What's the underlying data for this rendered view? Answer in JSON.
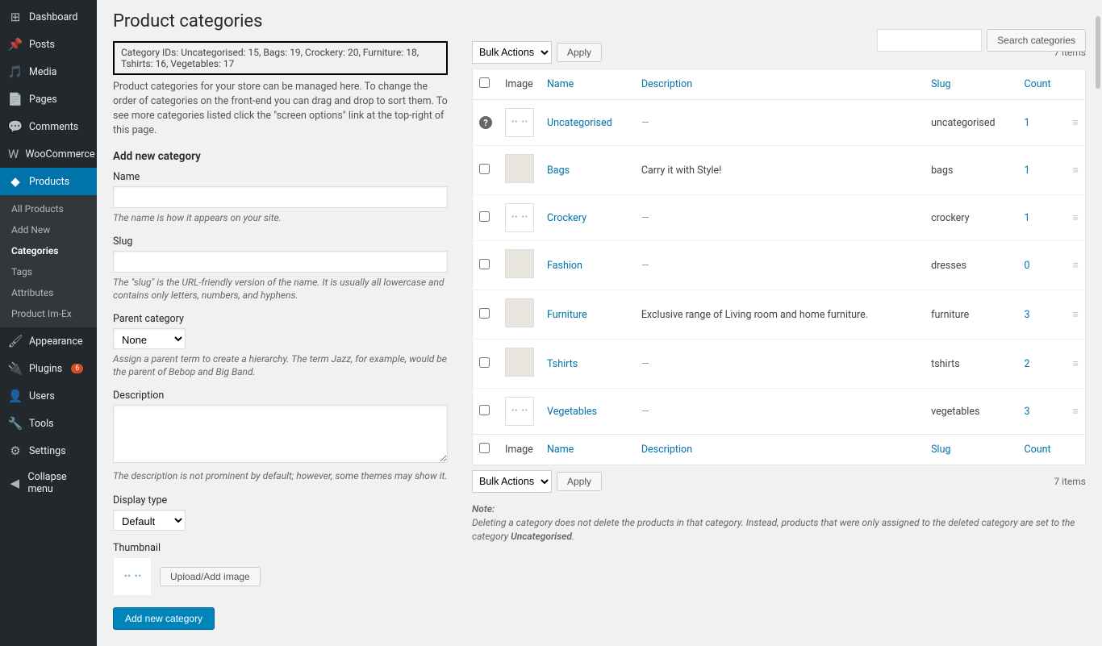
{
  "sidebar": {
    "items": [
      {
        "label": "Dashboard",
        "icon": "dashboard-icon"
      },
      {
        "label": "Posts",
        "icon": "pin-icon"
      },
      {
        "label": "Media",
        "icon": "media-icon"
      },
      {
        "label": "Pages",
        "icon": "page-icon"
      },
      {
        "label": "Comments",
        "icon": "comment-icon"
      },
      {
        "label": "WooCommerce",
        "icon": "woo-icon"
      },
      {
        "label": "Products",
        "icon": "product-icon",
        "active": true
      },
      {
        "label": "Appearance",
        "icon": "brush-icon"
      },
      {
        "label": "Plugins",
        "icon": "plug-icon",
        "badge": "6"
      },
      {
        "label": "Users",
        "icon": "user-icon"
      },
      {
        "label": "Tools",
        "icon": "wrench-icon"
      },
      {
        "label": "Settings",
        "icon": "gear-icon"
      },
      {
        "label": "Collapse menu",
        "icon": "collapse-icon"
      }
    ],
    "submenu": [
      "All Products",
      "Add New",
      "Categories",
      "Tags",
      "Attributes",
      "Product Im-Ex"
    ],
    "submenu_current": "Categories"
  },
  "page_title": "Product categories",
  "search": {
    "button": "Search categories"
  },
  "category_ids_label": "Category IDs:",
  "category_ids_value": "Uncategorised: 15, Bags: 19, Crockery: 20, Furniture: 18, Tshirts: 16, Vegetables: 17",
  "intro_help": "Product categories for your store can be managed here. To change the order of categories on the front-end you can drag and drop to sort them. To see more categories listed click the \"screen options\" link at the top-right of this page.",
  "form": {
    "heading": "Add new category",
    "name_label": "Name",
    "name_hint": "The name is how it appears on your site.",
    "slug_label": "Slug",
    "slug_hint": "The \"slug\" is the URL-friendly version of the name. It is usually all lowercase and contains only letters, numbers, and hyphens.",
    "parent_label": "Parent category",
    "parent_value": "None",
    "parent_hint": "Assign a parent term to create a hierarchy. The term Jazz, for example, would be the parent of Bebop and Big Band.",
    "desc_label": "Description",
    "desc_hint": "The description is not prominent by default; however, some themes may show it.",
    "display_label": "Display type",
    "display_value": "Default",
    "thumb_label": "Thumbnail",
    "upload_btn": "Upload/Add image",
    "submit": "Add new category"
  },
  "bulk": {
    "label": "Bulk Actions",
    "apply": "Apply"
  },
  "items_count": "7 items",
  "columns": {
    "image": "Image",
    "name": "Name",
    "description": "Description",
    "slug": "Slug",
    "count": "Count"
  },
  "rows": [
    {
      "name": "Uncategorised",
      "description": "—",
      "slug": "uncategorised",
      "count": "1",
      "thumb": "wc",
      "qmark": true
    },
    {
      "name": "Bags",
      "description": "Carry it with Style!",
      "slug": "bags",
      "count": "1",
      "thumb": "img"
    },
    {
      "name": "Crockery",
      "description": "—",
      "slug": "crockery",
      "count": "1",
      "thumb": "wc"
    },
    {
      "name": "Fashion",
      "description": "—",
      "slug": "dresses",
      "count": "0",
      "thumb": "img"
    },
    {
      "name": "Furniture",
      "description": "Exclusive range of Living room and home furniture.",
      "slug": "furniture",
      "count": "3",
      "thumb": "img"
    },
    {
      "name": "Tshirts",
      "description": "—",
      "slug": "tshirts",
      "count": "2",
      "thumb": "img"
    },
    {
      "name": "Vegetables",
      "description": "—",
      "slug": "vegetables",
      "count": "3",
      "thumb": "wc"
    }
  ],
  "note_label": "Note:",
  "note_text": "Deleting a category does not delete the products in that category. Instead, products that were only assigned to the deleted category are set to the category ",
  "note_em": "Uncategorised"
}
